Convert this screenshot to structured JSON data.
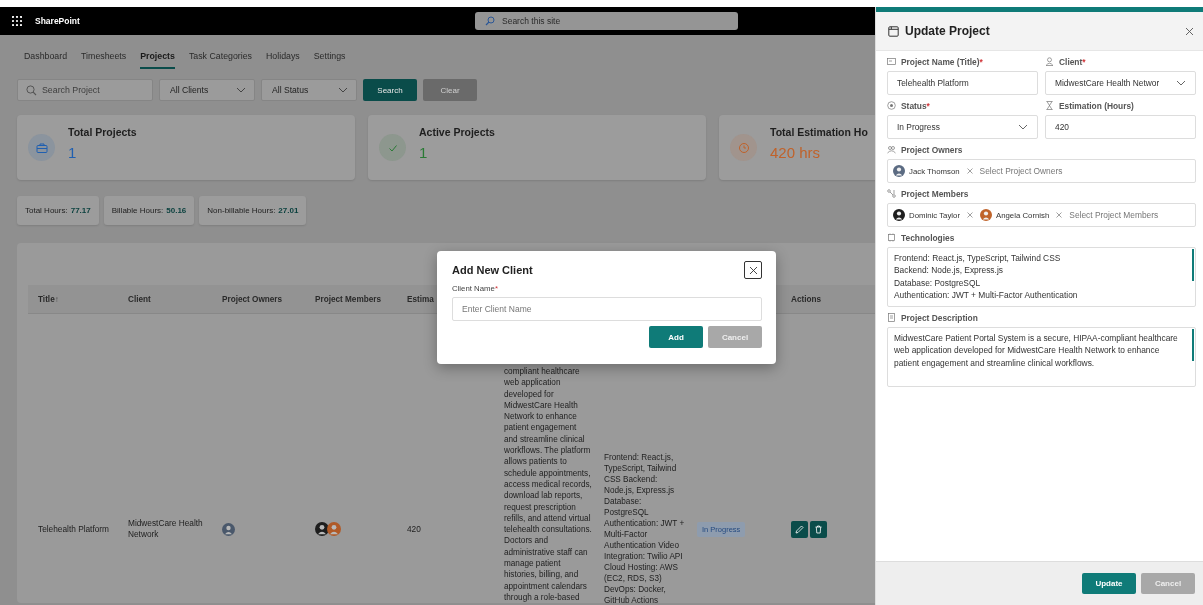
{
  "topbar": {
    "app_name": "SharePoint",
    "search_placeholder": "Search this site"
  },
  "tabs": [
    {
      "label": "Dashboard",
      "selected": false
    },
    {
      "label": "Timesheets",
      "selected": false
    },
    {
      "label": "Projects",
      "selected": true
    },
    {
      "label": "Task Categories",
      "selected": false
    },
    {
      "label": "Holidays",
      "selected": false
    },
    {
      "label": "Settings",
      "selected": false
    }
  ],
  "filters": {
    "search_placeholder": "Search Project",
    "client_select": "All Clients",
    "status_select": "All Status",
    "buttons": [
      {
        "label": "Search",
        "kind": "primary"
      },
      {
        "label": "Clear",
        "kind": "secondary"
      }
    ]
  },
  "stat_cards": [
    {
      "title": "Total Projects",
      "value": "1",
      "color": "#1f5fb0"
    },
    {
      "title": "Active Projects",
      "value": "1",
      "color": "#2a7a35"
    },
    {
      "title": "Total Estimation Ho",
      "value": "420 hrs",
      "color": "#c0622a"
    }
  ],
  "hours": [
    {
      "label": "Total Hours:",
      "value": "77.17"
    },
    {
      "label": "Billable Hours:",
      "value": "50.16"
    },
    {
      "label": "Non-billable Hours:",
      "value": "27.01"
    }
  ],
  "table": {
    "columns": [
      {
        "label": "Title",
        "sort_mark": "↑"
      },
      {
        "label": "Client"
      },
      {
        "label": "Project Owners"
      },
      {
        "label": "Project Members"
      },
      {
        "label": "Estima"
      },
      {
        "label": "Actions"
      }
    ],
    "rows": [
      {
        "title": "Telehealth Platform",
        "client": "MidwestCare Health Network",
        "owners": [
          {
            "color": "#4a586b"
          }
        ],
        "members": [
          {
            "color": "#1e1e1e"
          },
          {
            "color": "#b05a28"
          }
        ],
        "estimation": "420",
        "description": "compliant healthcare web application developed for MidwestCare Health Network to enhance patient engagement and streamline clinical workflows. The platform allows patients to schedule appointments, access medical records, download lab reports, request prescription refills, and attend virtual telehealth consultations. Doctors and administrative staff can manage patient histories, billing, and appointment calendars through a role-based",
        "technologies": "Frontend: React.js, TypeScript, Tailwind CSS Backend: Node.js, Express.js Database: PostgreSQL Authentication: JWT + Multi-Factor Authentication Video Integration: Twilio API Cloud Hosting: AWS (EC2, RDS, S3) DevOps: Docker, GitHub Actions",
        "status": "In Progress"
      }
    ]
  },
  "modal": {
    "title": "Add New Client",
    "field_label": "Client Name",
    "required_mark": "*",
    "placeholder": "Enter Client Name",
    "buttons": [
      {
        "label": "Add",
        "kind": "primary"
      },
      {
        "label": "Cancel",
        "kind": "secondary"
      }
    ]
  },
  "panel": {
    "title": "Update Project",
    "rows": [
      [
        {
          "kind": "text",
          "label": "Project Name (Title)",
          "required_mark": "*",
          "value": "Telehealth Platform"
        },
        {
          "kind": "select",
          "label": "Client",
          "required_mark": "*",
          "value": "MidwestCare Health Networ"
        }
      ],
      [
        {
          "kind": "select",
          "label": "Status",
          "required_mark": "*",
          "value": "In Progress"
        },
        {
          "kind": "text",
          "label": "Estimation (Hours)",
          "value": "420"
        }
      ],
      [
        {
          "kind": "people",
          "label": "Project Owners",
          "people": [
            {
              "name": "Jack Thomson",
              "color": "#5b6b82"
            }
          ],
          "placeholder": "Select Project Owners"
        }
      ],
      [
        {
          "kind": "people",
          "label": "Project Members",
          "people": [
            {
              "name": "Dominic Taylor",
              "color": "#1e1e1e"
            },
            {
              "name": "Angela Cornish",
              "color": "#c0642b"
            }
          ],
          "placeholder": "Select Project Members"
        }
      ],
      [
        {
          "kind": "textarea",
          "label": "Technologies",
          "value": "Frontend: React.js, TypeScript, Tailwind CSS\nBackend: Node.js, Express.js\nDatabase: PostgreSQL\nAuthentication: JWT + Multi-Factor Authentication"
        }
      ],
      [
        {
          "kind": "textarea",
          "label": "Project Description",
          "value": "MidwestCare Patient Portal System is a secure, HIPAA-compliant healthcare web application developed for MidwestCare Health Network to enhance patient engagement and streamline clinical workflows."
        }
      ]
    ],
    "buttons": [
      {
        "label": "Update",
        "kind": "primary"
      },
      {
        "label": "Cancel",
        "kind": "secondary"
      }
    ]
  }
}
